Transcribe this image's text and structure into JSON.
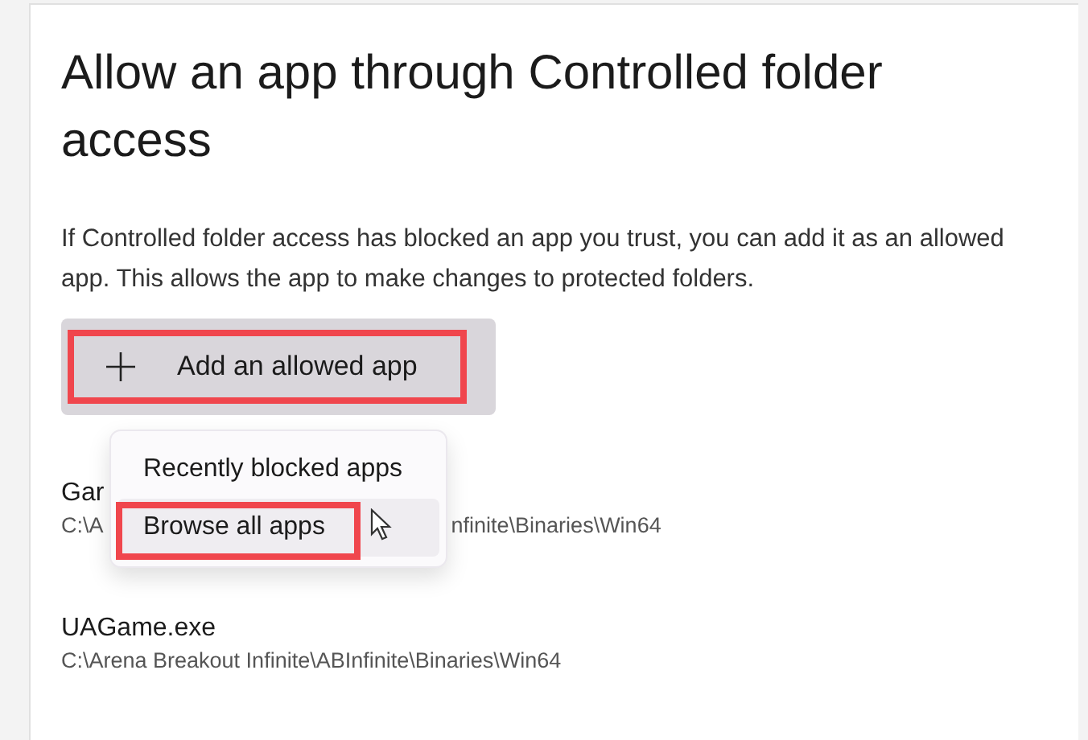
{
  "title": "Allow an app through Controlled folder access",
  "description": "If Controlled folder access has blocked an app you trust, you can add it as an allowed app. This allows the app to make changes to protected folders.",
  "add_button": {
    "label": "Add an allowed app",
    "highlighted": true
  },
  "menu": {
    "items": [
      {
        "label": "Recently blocked apps",
        "selected": false,
        "highlighted": false
      },
      {
        "label": "Browse all apps",
        "selected": true,
        "highlighted": true
      }
    ]
  },
  "apps": [
    {
      "name": "Gar",
      "path_start": "C:\\A",
      "path_end": "nfinite\\Binaries\\Win64"
    },
    {
      "name": "UAGame.exe",
      "path": "C:\\Arena Breakout Infinite\\ABInfinite\\Binaries\\Win64"
    }
  ]
}
